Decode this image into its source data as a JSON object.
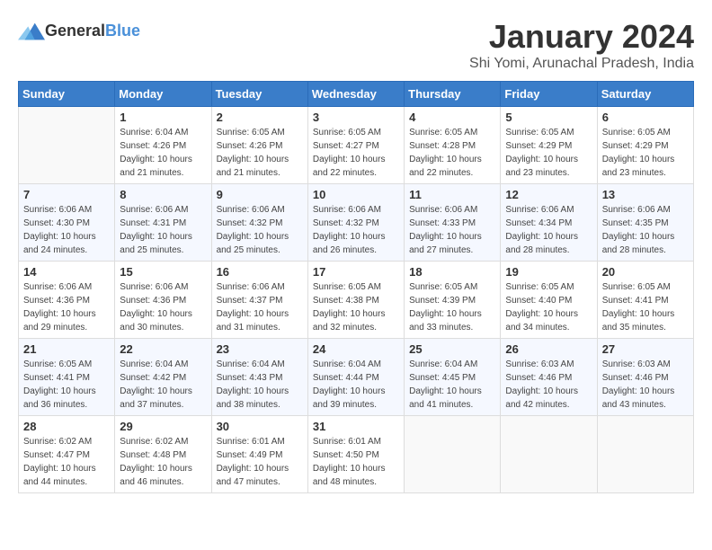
{
  "header": {
    "logo_general": "General",
    "logo_blue": "Blue",
    "title": "January 2024",
    "subtitle": "Shi Yomi, Arunachal Pradesh, India"
  },
  "weekdays": [
    "Sunday",
    "Monday",
    "Tuesday",
    "Wednesday",
    "Thursday",
    "Friday",
    "Saturday"
  ],
  "weeks": [
    [
      {
        "day": "",
        "sunrise": "",
        "sunset": "",
        "daylight": ""
      },
      {
        "day": "1",
        "sunrise": "Sunrise: 6:04 AM",
        "sunset": "Sunset: 4:26 PM",
        "daylight": "Daylight: 10 hours and 21 minutes."
      },
      {
        "day": "2",
        "sunrise": "Sunrise: 6:05 AM",
        "sunset": "Sunset: 4:26 PM",
        "daylight": "Daylight: 10 hours and 21 minutes."
      },
      {
        "day": "3",
        "sunrise": "Sunrise: 6:05 AM",
        "sunset": "Sunset: 4:27 PM",
        "daylight": "Daylight: 10 hours and 22 minutes."
      },
      {
        "day": "4",
        "sunrise": "Sunrise: 6:05 AM",
        "sunset": "Sunset: 4:28 PM",
        "daylight": "Daylight: 10 hours and 22 minutes."
      },
      {
        "day": "5",
        "sunrise": "Sunrise: 6:05 AM",
        "sunset": "Sunset: 4:29 PM",
        "daylight": "Daylight: 10 hours and 23 minutes."
      },
      {
        "day": "6",
        "sunrise": "Sunrise: 6:05 AM",
        "sunset": "Sunset: 4:29 PM",
        "daylight": "Daylight: 10 hours and 23 minutes."
      }
    ],
    [
      {
        "day": "7",
        "sunrise": "Sunrise: 6:06 AM",
        "sunset": "Sunset: 4:30 PM",
        "daylight": "Daylight: 10 hours and 24 minutes."
      },
      {
        "day": "8",
        "sunrise": "Sunrise: 6:06 AM",
        "sunset": "Sunset: 4:31 PM",
        "daylight": "Daylight: 10 hours and 25 minutes."
      },
      {
        "day": "9",
        "sunrise": "Sunrise: 6:06 AM",
        "sunset": "Sunset: 4:32 PM",
        "daylight": "Daylight: 10 hours and 25 minutes."
      },
      {
        "day": "10",
        "sunrise": "Sunrise: 6:06 AM",
        "sunset": "Sunset: 4:32 PM",
        "daylight": "Daylight: 10 hours and 26 minutes."
      },
      {
        "day": "11",
        "sunrise": "Sunrise: 6:06 AM",
        "sunset": "Sunset: 4:33 PM",
        "daylight": "Daylight: 10 hours and 27 minutes."
      },
      {
        "day": "12",
        "sunrise": "Sunrise: 6:06 AM",
        "sunset": "Sunset: 4:34 PM",
        "daylight": "Daylight: 10 hours and 28 minutes."
      },
      {
        "day": "13",
        "sunrise": "Sunrise: 6:06 AM",
        "sunset": "Sunset: 4:35 PM",
        "daylight": "Daylight: 10 hours and 28 minutes."
      }
    ],
    [
      {
        "day": "14",
        "sunrise": "Sunrise: 6:06 AM",
        "sunset": "Sunset: 4:36 PM",
        "daylight": "Daylight: 10 hours and 29 minutes."
      },
      {
        "day": "15",
        "sunrise": "Sunrise: 6:06 AM",
        "sunset": "Sunset: 4:36 PM",
        "daylight": "Daylight: 10 hours and 30 minutes."
      },
      {
        "day": "16",
        "sunrise": "Sunrise: 6:06 AM",
        "sunset": "Sunset: 4:37 PM",
        "daylight": "Daylight: 10 hours and 31 minutes."
      },
      {
        "day": "17",
        "sunrise": "Sunrise: 6:05 AM",
        "sunset": "Sunset: 4:38 PM",
        "daylight": "Daylight: 10 hours and 32 minutes."
      },
      {
        "day": "18",
        "sunrise": "Sunrise: 6:05 AM",
        "sunset": "Sunset: 4:39 PM",
        "daylight": "Daylight: 10 hours and 33 minutes."
      },
      {
        "day": "19",
        "sunrise": "Sunrise: 6:05 AM",
        "sunset": "Sunset: 4:40 PM",
        "daylight": "Daylight: 10 hours and 34 minutes."
      },
      {
        "day": "20",
        "sunrise": "Sunrise: 6:05 AM",
        "sunset": "Sunset: 4:41 PM",
        "daylight": "Daylight: 10 hours and 35 minutes."
      }
    ],
    [
      {
        "day": "21",
        "sunrise": "Sunrise: 6:05 AM",
        "sunset": "Sunset: 4:41 PM",
        "daylight": "Daylight: 10 hours and 36 minutes."
      },
      {
        "day": "22",
        "sunrise": "Sunrise: 6:04 AM",
        "sunset": "Sunset: 4:42 PM",
        "daylight": "Daylight: 10 hours and 37 minutes."
      },
      {
        "day": "23",
        "sunrise": "Sunrise: 6:04 AM",
        "sunset": "Sunset: 4:43 PM",
        "daylight": "Daylight: 10 hours and 38 minutes."
      },
      {
        "day": "24",
        "sunrise": "Sunrise: 6:04 AM",
        "sunset": "Sunset: 4:44 PM",
        "daylight": "Daylight: 10 hours and 39 minutes."
      },
      {
        "day": "25",
        "sunrise": "Sunrise: 6:04 AM",
        "sunset": "Sunset: 4:45 PM",
        "daylight": "Daylight: 10 hours and 41 minutes."
      },
      {
        "day": "26",
        "sunrise": "Sunrise: 6:03 AM",
        "sunset": "Sunset: 4:46 PM",
        "daylight": "Daylight: 10 hours and 42 minutes."
      },
      {
        "day": "27",
        "sunrise": "Sunrise: 6:03 AM",
        "sunset": "Sunset: 4:46 PM",
        "daylight": "Daylight: 10 hours and 43 minutes."
      }
    ],
    [
      {
        "day": "28",
        "sunrise": "Sunrise: 6:02 AM",
        "sunset": "Sunset: 4:47 PM",
        "daylight": "Daylight: 10 hours and 44 minutes."
      },
      {
        "day": "29",
        "sunrise": "Sunrise: 6:02 AM",
        "sunset": "Sunset: 4:48 PM",
        "daylight": "Daylight: 10 hours and 46 minutes."
      },
      {
        "day": "30",
        "sunrise": "Sunrise: 6:01 AM",
        "sunset": "Sunset: 4:49 PM",
        "daylight": "Daylight: 10 hours and 47 minutes."
      },
      {
        "day": "31",
        "sunrise": "Sunrise: 6:01 AM",
        "sunset": "Sunset: 4:50 PM",
        "daylight": "Daylight: 10 hours and 48 minutes."
      },
      {
        "day": "",
        "sunrise": "",
        "sunset": "",
        "daylight": ""
      },
      {
        "day": "",
        "sunrise": "",
        "sunset": "",
        "daylight": ""
      },
      {
        "day": "",
        "sunrise": "",
        "sunset": "",
        "daylight": ""
      }
    ]
  ]
}
